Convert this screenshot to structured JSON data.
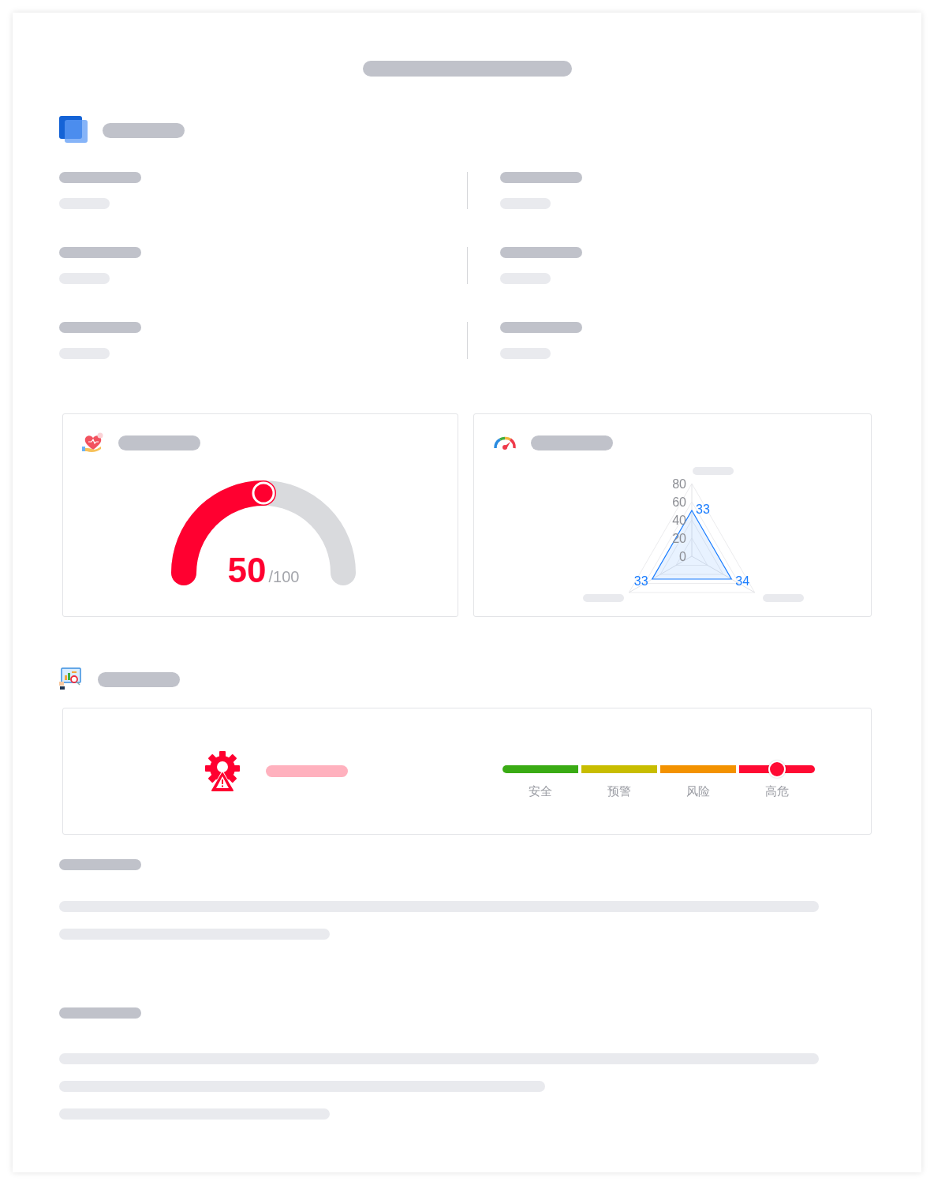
{
  "gauge_card": {
    "score": "50",
    "max": "/100",
    "level": 0.5
  },
  "radar_card": {
    "scale_labels": [
      "80",
      "60",
      "40",
      "20",
      "0"
    ],
    "point_labels": [
      "33",
      "34",
      "33"
    ]
  },
  "risk": {
    "levels": [
      {
        "label": "安全",
        "color": "#3aab14",
        "selected": false
      },
      {
        "label": "预警",
        "color": "#c8bd00",
        "selected": false
      },
      {
        "label": "风险",
        "color": "#f39200",
        "selected": false
      },
      {
        "label": "高危",
        "color": "#ff0a33",
        "selected": true
      }
    ]
  }
}
